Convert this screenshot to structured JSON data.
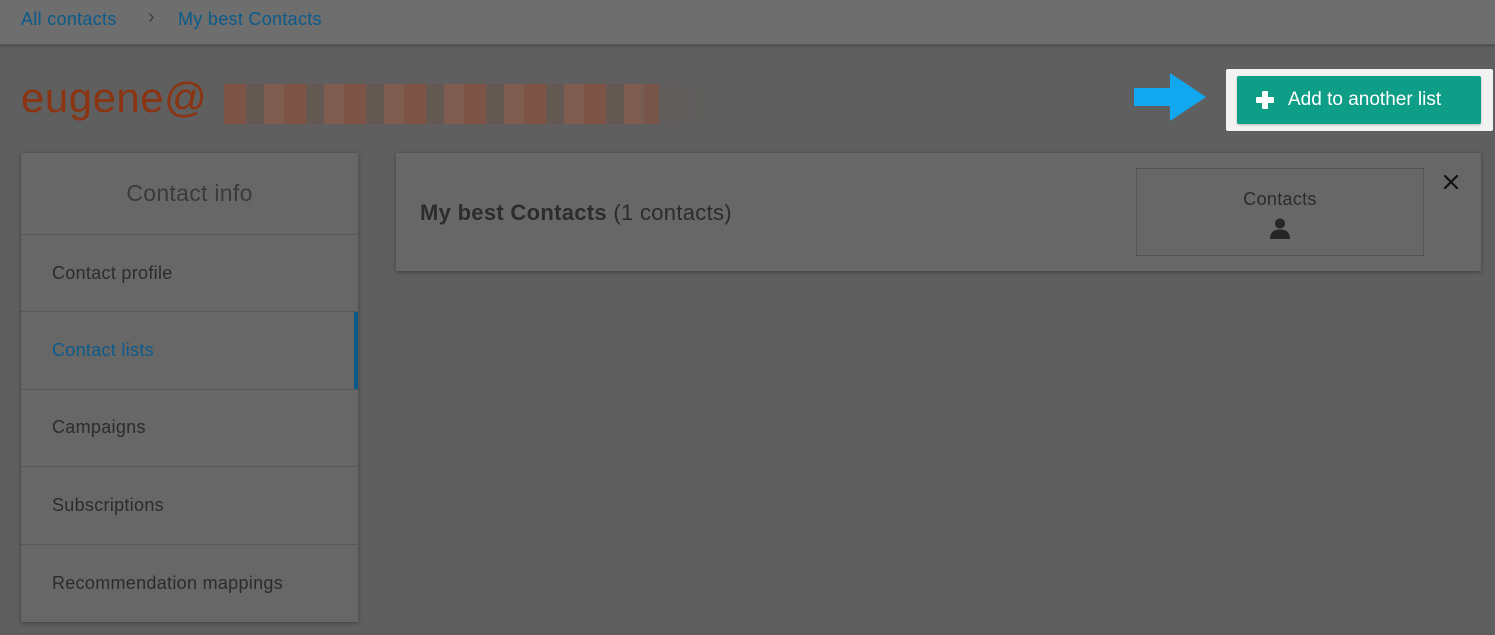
{
  "breadcrumb": {
    "items": [
      "All contacts",
      "My best Contacts"
    ],
    "separator": "›"
  },
  "contact": {
    "email_visible": "eugene@"
  },
  "actions": {
    "add_to_list_label": "Add to another list"
  },
  "sidebar": {
    "header": "Contact info",
    "items": [
      {
        "label": "Contact profile",
        "active": false
      },
      {
        "label": "Contact lists",
        "active": true
      },
      {
        "label": "Campaigns",
        "active": false
      },
      {
        "label": "Subscriptions",
        "active": false
      },
      {
        "label": "Recommendation mappings",
        "active": false
      }
    ]
  },
  "list_card": {
    "name": "My best Contacts",
    "count_text": "(1 contacts)",
    "contacts_label": "Contacts"
  },
  "colors": {
    "accent_blue": "#0b5b8a",
    "button_teal": "#0e9d87",
    "email_orange": "#8a3412",
    "arrow_blue": "#12a8f0",
    "overlay_gray": "#5f5f5f"
  },
  "icons": {
    "breadcrumb_separator": "chevron-right-icon",
    "add_button": "plus-icon",
    "contacts": "person-icon",
    "close": "close-icon",
    "callout": "arrow-right-icon"
  }
}
